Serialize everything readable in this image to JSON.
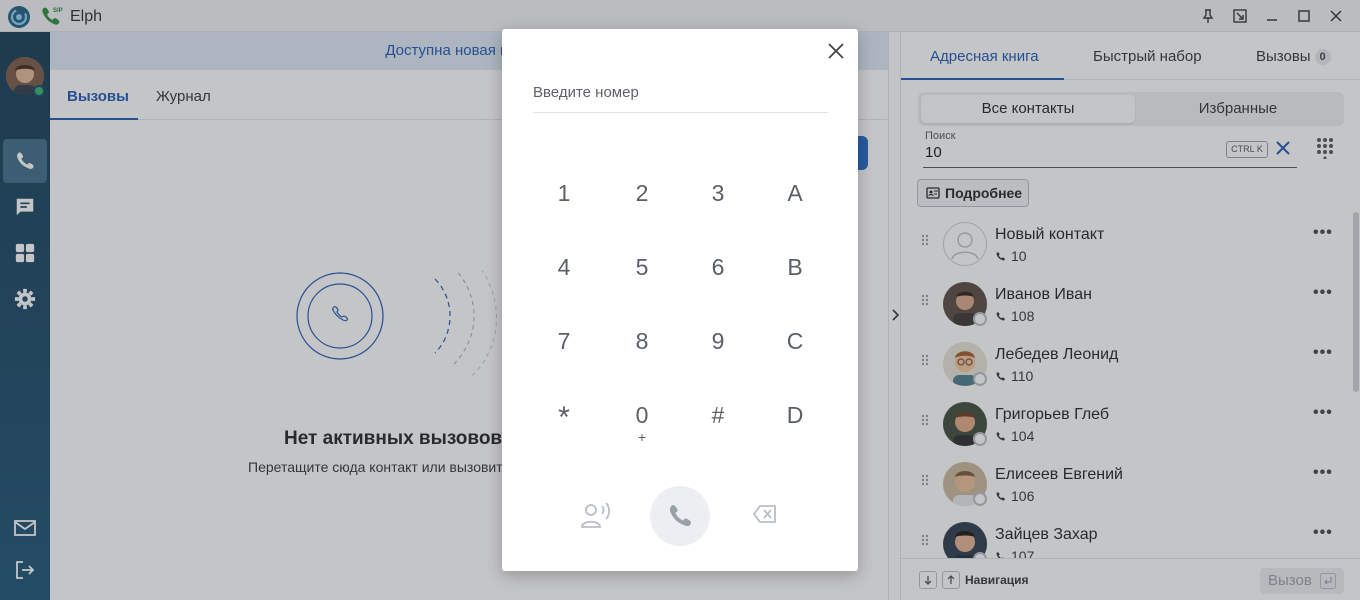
{
  "app": {
    "title": "Elph",
    "sip_label": "SIP"
  },
  "banner": {
    "text": "Доступна новая версия!"
  },
  "center_tabs": [
    {
      "label": "Вызовы"
    },
    {
      "label": "Журнал"
    }
  ],
  "empty_state": {
    "title": "Нет активных вызовов",
    "subtitle": "Перетащите сюда контакт или вызовите"
  },
  "dialer": {
    "placeholder": "Введите номер",
    "keys": [
      {
        "label": "1"
      },
      {
        "label": "2"
      },
      {
        "label": "3"
      },
      {
        "label": "A"
      },
      {
        "label": "4"
      },
      {
        "label": "5"
      },
      {
        "label": "6"
      },
      {
        "label": "B"
      },
      {
        "label": "7"
      },
      {
        "label": "8"
      },
      {
        "label": "9"
      },
      {
        "label": "C"
      },
      {
        "label": "*"
      },
      {
        "label": "0",
        "sub": "+"
      },
      {
        "label": "#"
      },
      {
        "label": "D"
      }
    ]
  },
  "right_tabs": [
    {
      "label": "Адресная книга"
    },
    {
      "label": "Быстрый набор"
    },
    {
      "label": "Вызовы",
      "badge": "0"
    }
  ],
  "filter": {
    "all": "Все контакты",
    "favorites": "Избранные"
  },
  "search": {
    "label": "Поиск",
    "value": "10",
    "shortcut": "CTRL K"
  },
  "more_button": {
    "label": "Подробнее"
  },
  "contacts": [
    {
      "name": "Новый контакт",
      "number": "10"
    },
    {
      "name": "Иванов Иван",
      "number": "108"
    },
    {
      "name": "Лебедев Леонид",
      "number": "110"
    },
    {
      "name": "Григорьев Глеб",
      "number": "104"
    },
    {
      "name": "Елисеев Евгений",
      "number": "106"
    },
    {
      "name": "Зайцев Захар",
      "number": "107"
    }
  ],
  "footer": {
    "nav_label": "Навигация",
    "call_label": "Вызов"
  },
  "colors": {
    "accent": "#1f56b3",
    "sidebar": "#184865",
    "online": "#30b36b"
  }
}
